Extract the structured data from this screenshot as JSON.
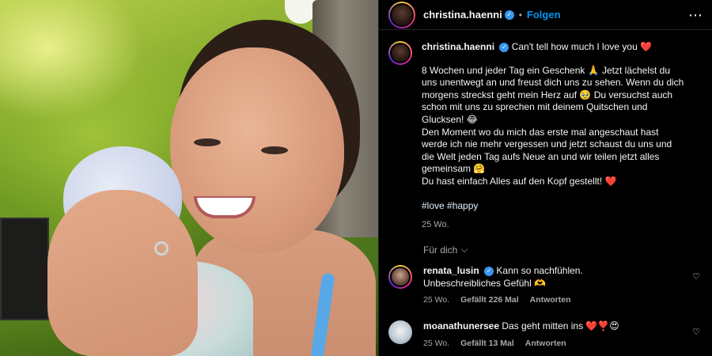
{
  "post": {
    "username": "christina.haenni",
    "follow_label": "Folgen",
    "separator": "•",
    "more_icon": "⋯",
    "verified_mark": "✓"
  },
  "caption": {
    "username": "christina.haenni",
    "first_line": "Can't tell how much I love you ❤️",
    "lines": [
      "8 Wochen und jeder Tag ein Geschenk 🙏 Jetzt lächelst du",
      "uns unentwegt an und freust dich uns zu sehen. Wenn du dich",
      "morgens streckst geht mein Herz auf 🥹 Du versuchst auch",
      "schon mit uns zu sprechen mit deinem Quitschen und",
      "Glucksen! 😂",
      "Den Moment wo du mich das erste mal angeschaut hast",
      "werde ich nie mehr vergessen und jetzt schaust du uns und",
      "die Welt jeden Tag aufs Neue an und wir teilen jetzt alles",
      "gemeinsam 🤗",
      "Du hast einfach Alles auf den Kopf gestellt! ❤️"
    ],
    "hashtags": "#love #happy",
    "time": "25 Wo."
  },
  "for_you": {
    "label": "Für dich",
    "chevron": "⌵"
  },
  "comments": [
    {
      "username": "renata_lusin",
      "verified": true,
      "text_line1": "Kann so nachfühlen.",
      "text_line2": "Unbeschreibliches Gefühl 🫶",
      "time": "25 Wo.",
      "likes": "Gefällt 226 Mal",
      "reply": "Antworten"
    },
    {
      "username": "moanathunersee",
      "verified": false,
      "text_line1": "Das geht mitten ins ❤️❣️😍",
      "time": "25 Wo.",
      "likes": "Gefällt 13 Mal",
      "reply": "Antworten"
    }
  ],
  "icons": {
    "heart": "♡"
  },
  "colors": {
    "follow": "#0095f6",
    "verified": "#3897f0",
    "muted": "#a8a8a8",
    "background": "#000000"
  }
}
